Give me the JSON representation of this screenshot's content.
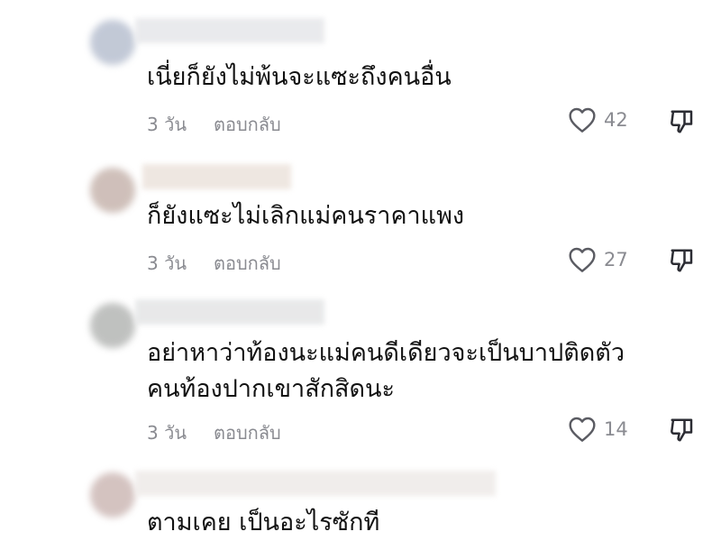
{
  "comments": [
    {
      "text": "เนี่ยก็ยังไม่พ้นจะแซะถึงคนอื่น",
      "time": "3 วัน",
      "reply_label": "ตอบกลับ",
      "likes": "42"
    },
    {
      "text": "ก็ยังแซะไม่เลิกแม่คนราคาแพง",
      "time": "3 วัน",
      "reply_label": "ตอบกลับ",
      "likes": "27"
    },
    {
      "text": "อย่าหาว่าท้องนะแม่คนดีเดียวจะเป็นบาปติดตัว\nคนท้องปากเขาสักสิดนะ",
      "time": "3 วัน",
      "reply_label": "ตอบกลับ",
      "likes": "14"
    },
    {
      "text": "ตามเคย เป็นอะไรซักที"
    }
  ],
  "icons": {
    "like": "heart-outline-icon",
    "dislike": "thumbs-down-icon"
  },
  "colors": {
    "text": "#111111",
    "meta": "#8a8b91"
  }
}
